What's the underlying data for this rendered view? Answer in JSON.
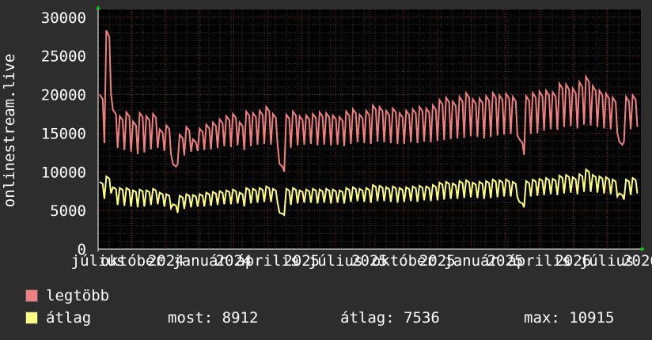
{
  "chart_data": {
    "type": "line",
    "ylabel": "onlinestream.live",
    "ylim": [
      0,
      31000
    ],
    "grid": true,
    "y_ticks": [
      "0",
      "5000",
      "10000",
      "15000",
      "20000",
      "25000",
      "30000"
    ],
    "x_ticks": [
      "július",
      "október",
      "2024",
      "január",
      "2024",
      "április",
      "2025",
      "július",
      "2025",
      "október",
      "2025",
      "január",
      "2025",
      "április",
      "2026",
      "július",
      "2026"
    ],
    "series": [
      {
        "name": "legtöbb",
        "color": "#f08080",
        "values": [
          20000,
          28300,
          18000,
          17200,
          17700,
          16500,
          17600,
          17200,
          17500,
          15500,
          16000,
          11000,
          14800,
          15800,
          14200,
          15600,
          16100,
          16400,
          16800,
          17200,
          17500,
          16400,
          17800,
          17600,
          17900,
          18400,
          17500,
          11000,
          17400,
          17800,
          17200,
          17300,
          17500,
          17700,
          17600,
          17300,
          17100,
          17800,
          18100,
          17400,
          17900,
          18600,
          18400,
          17900,
          18200,
          17600,
          17900,
          18100,
          18400,
          18200,
          18600,
          19300,
          19600,
          19100,
          19700,
          20200,
          19400,
          19500,
          19800,
          20200,
          19900,
          20100,
          19700,
          14200,
          19800,
          20200,
          20400,
          20500,
          20300,
          21400,
          21300,
          20800,
          21600,
          22300,
          21100,
          20500,
          20100,
          19600,
          13900,
          19700,
          19900
        ],
        "low": [
          13700,
          20000,
          13100,
          12800,
          12600,
          12300,
          12500,
          12900,
          13100,
          12700,
          12300,
          11000,
          12100,
          12600,
          12700,
          12800,
          12900,
          13100,
          13300,
          13200,
          13400,
          12800,
          13300,
          13500,
          13600,
          13500,
          13500,
          10000,
          13100,
          13400,
          13500,
          13600,
          13400,
          13500,
          13400,
          13500,
          13300,
          13600,
          13800,
          13700,
          13600,
          13900,
          13800,
          13700,
          13600,
          13600,
          13800,
          13700,
          13900,
          13800,
          14000,
          14100,
          14200,
          14300,
          14400,
          14600,
          14500,
          14300,
          14500,
          14700,
          14800,
          14900,
          14700,
          12200,
          14900,
          15000,
          15300,
          15500,
          15400,
          15800,
          15900,
          15600,
          16100,
          16000,
          15800,
          15600,
          15500,
          15000,
          13900,
          15500,
          15800
        ]
      },
      {
        "name": "átlag",
        "color": "#ffff80",
        "values": [
          8700,
          9400,
          8000,
          7900,
          7900,
          7600,
          7700,
          7600,
          7800,
          7300,
          7100,
          5800,
          6900,
          7100,
          7000,
          7100,
          7300,
          7400,
          7500,
          7600,
          7700,
          7300,
          7900,
          7800,
          7900,
          8100,
          7800,
          4700,
          7800,
          7900,
          7600,
          7700,
          7800,
          7700,
          7800,
          7700,
          7600,
          7900,
          8000,
          7800,
          7900,
          8300,
          8200,
          8000,
          8100,
          7900,
          8000,
          8100,
          8200,
          8100,
          8300,
          8600,
          8700,
          8500,
          8800,
          8900,
          8600,
          8700,
          8800,
          9000,
          8900,
          9000,
          8700,
          6100,
          8800,
          9000,
          9100,
          9200,
          9100,
          9500,
          9600,
          9300,
          9700,
          10300,
          9600,
          9400,
          9300,
          9000,
          7200,
          9000,
          9200
        ],
        "low": [
          6500,
          7200,
          5700,
          5600,
          5500,
          5400,
          5500,
          5700,
          5800,
          5500,
          5300,
          4700,
          5200,
          5400,
          5500,
          5500,
          5600,
          5700,
          5800,
          5800,
          5900,
          5500,
          5900,
          6000,
          6100,
          6100,
          6000,
          4400,
          5700,
          5900,
          6000,
          6000,
          5900,
          6000,
          5900,
          6000,
          5900,
          6100,
          6200,
          6100,
          6000,
          6200,
          6200,
          6100,
          6000,
          6100,
          6200,
          6100,
          6300,
          6200,
          6300,
          6400,
          6500,
          6500,
          6600,
          6700,
          6600,
          6500,
          6600,
          6700,
          6800,
          6800,
          6700,
          5400,
          6800,
          6900,
          7000,
          7100,
          7000,
          7200,
          7300,
          7100,
          7400,
          7400,
          7300,
          7200,
          7100,
          6800,
          6400,
          7000,
          7200
        ]
      }
    ]
  },
  "legend": {
    "series1": {
      "label": "legtöbb",
      "color": "#f08080"
    },
    "series2": {
      "label": "átlag",
      "color": "#ffff80"
    }
  },
  "stats": {
    "most": "most: 8912",
    "atlag": "átlag: 7536",
    "max": "max: 10915"
  }
}
